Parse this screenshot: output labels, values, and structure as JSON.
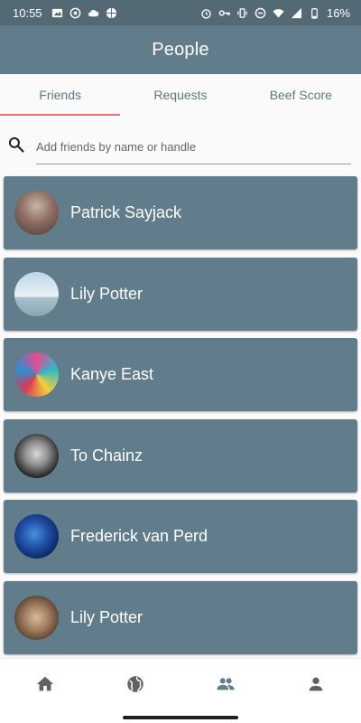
{
  "status_bar": {
    "time": "10:55",
    "battery_text": "16%"
  },
  "app_bar": {
    "title": "People"
  },
  "tabs": [
    {
      "label": "Friends",
      "active": true
    },
    {
      "label": "Requests",
      "active": false
    },
    {
      "label": "Beef Score",
      "active": false
    }
  ],
  "search": {
    "placeholder": "Add friends by name or handle",
    "value": ""
  },
  "friends": [
    {
      "name": "Patrick Sayjack"
    },
    {
      "name": "Lily Potter"
    },
    {
      "name": "Kanye East"
    },
    {
      "name": "To Chainz"
    },
    {
      "name": "Frederick van Perd"
    },
    {
      "name": "Lily Potter"
    }
  ],
  "bottom_nav": [
    {
      "icon": "home-icon"
    },
    {
      "icon": "globe-icon"
    },
    {
      "icon": "people-icon",
      "active": true
    },
    {
      "icon": "person-icon"
    }
  ],
  "colors": {
    "status_bar": "#536a75",
    "app_bar": "#617d8b",
    "card": "#617d8b",
    "tab_indicator": "#e57373",
    "tab_text": "#5f7783",
    "nav_icon": "#616161",
    "nav_icon_active": "#617d8b"
  }
}
